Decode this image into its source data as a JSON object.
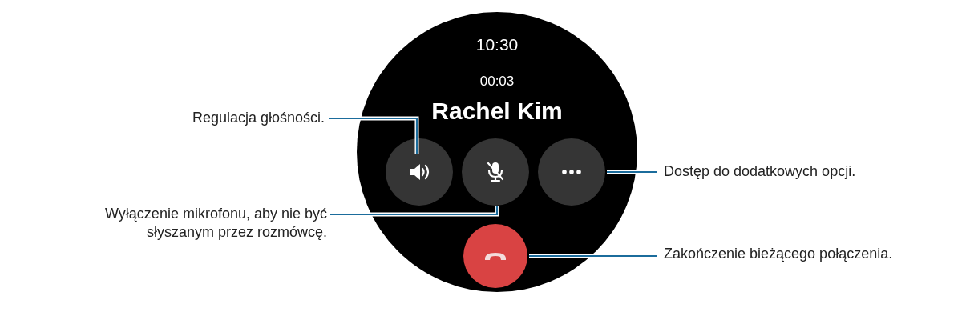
{
  "watch": {
    "time": "10:30",
    "duration": "00:03",
    "caller": "Rachel Kim",
    "buttons": [
      {
        "kind": "volume"
      },
      {
        "kind": "mute"
      },
      {
        "kind": "more"
      },
      {
        "kind": "end"
      }
    ]
  },
  "callouts": [
    {
      "text": "Regulacja głośności."
    },
    {
      "text": "Wyłączenie mikrofonu, aby nie być słyszanym przez rozmówcę."
    },
    {
      "text": "Dostęp do dodatkowych opcji."
    },
    {
      "text": "Zakończenie bieżącego połączenia."
    }
  ]
}
